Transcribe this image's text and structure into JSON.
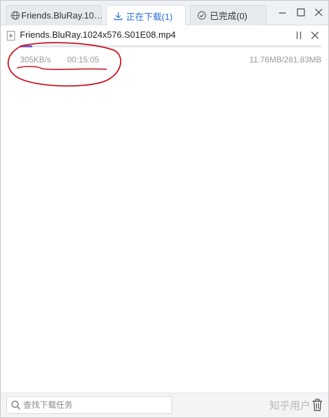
{
  "tabs": [
    {
      "label": "Friends.BluRay.10…",
      "icon": "globe-icon"
    },
    {
      "label": "正在下载(1)",
      "icon": "download-icon",
      "active": true
    },
    {
      "label": "已完成(0)",
      "icon": "check-circle-icon"
    }
  ],
  "window_controls": [
    "minimize-icon",
    "maximize-icon",
    "close-icon"
  ],
  "task": {
    "file_name": "Friends.BluRay.1024x576.S01E08.mp4",
    "speed": "305KB/s",
    "remaining": "00:15:05",
    "size": "11.76MB/281.83MB",
    "progress_fraction": 0.042,
    "progress_color": "#7a5cc9"
  },
  "search": {
    "placeholder": "查找下载任务",
    "value": ""
  },
  "watermark": "知乎用户",
  "colors": {
    "accent": "#2a6fdb",
    "annotation": "#c8141e"
  }
}
